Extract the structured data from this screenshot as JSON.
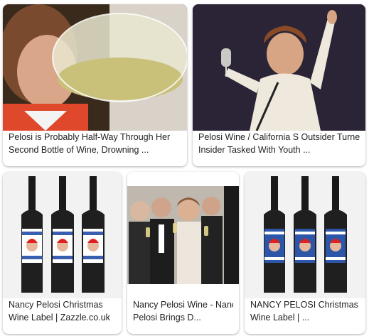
{
  "results": [
    {
      "caption_line1": "Pelosi is Probably Half-Way Through Her",
      "caption_line2": "Second Bottle of Wine, Drowning ..."
    },
    {
      "caption_line1": "Pelosi Wine / California S Outsider Turned",
      "caption_line2": "Insider Tasked With Youth ..."
    },
    {
      "caption_line1": "Nancy Pelosi Christmas",
      "caption_line2": "Wine Label | Zazzle.co.uk"
    },
    {
      "caption_line1": "Nancy Pelosi Wine - Nancy",
      "caption_line2": "Pelosi Brings D..."
    },
    {
      "caption_line1": "NANCY PELOSI Christmas",
      "caption_line2": "Wine Label | ..."
    }
  ]
}
